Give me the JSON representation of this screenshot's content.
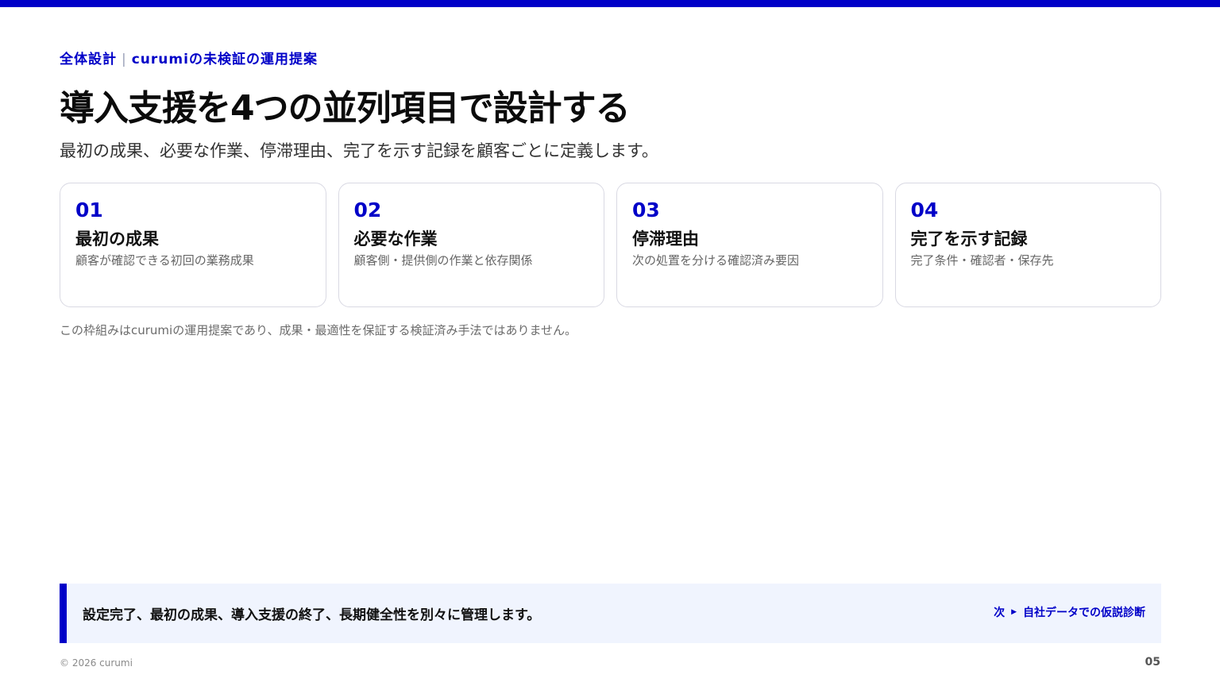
{
  "header": {
    "eyebrow_left": "全体設計",
    "eyebrow_separator": "|",
    "eyebrow_right": "curumiの未検証の運用提案",
    "title": "導入支援を4つの並列項目で設計する",
    "subtitle": "最初の成果、必要な作業、停滞理由、完了を示す記録を顧客ごとに定義します。"
  },
  "cards": [
    {
      "number": "01",
      "title": "最初の成果",
      "description": "顧客が確認できる初回の業務成果"
    },
    {
      "number": "02",
      "title": "必要な作業",
      "description": "顧客側・提供側の作業と依存関係"
    },
    {
      "number": "03",
      "title": "停滞理由",
      "description": "次の処置を分ける確認済み要因"
    },
    {
      "number": "04",
      "title": "完了を示す記録",
      "description": "完了条件・確認者・保存先"
    }
  ],
  "note": "この枠組みはcurumiの運用提案であり、成果・最適性を保証する検証済み手法ではありません。",
  "callout": {
    "text": "設定完了、最初の成果、導入支援の終了、長期健全性を別々に管理します。",
    "next_prefix": "次",
    "next_arrow_icon": "triangle-right-icon",
    "next_label": "自社データでの仮説診断"
  },
  "footer": {
    "copyright": "© 2026 curumi",
    "page_number": "05"
  },
  "colors": {
    "accent": "#0000c8",
    "callout_bg": "#f0f4fe",
    "card_border": "#d9d9e3"
  }
}
